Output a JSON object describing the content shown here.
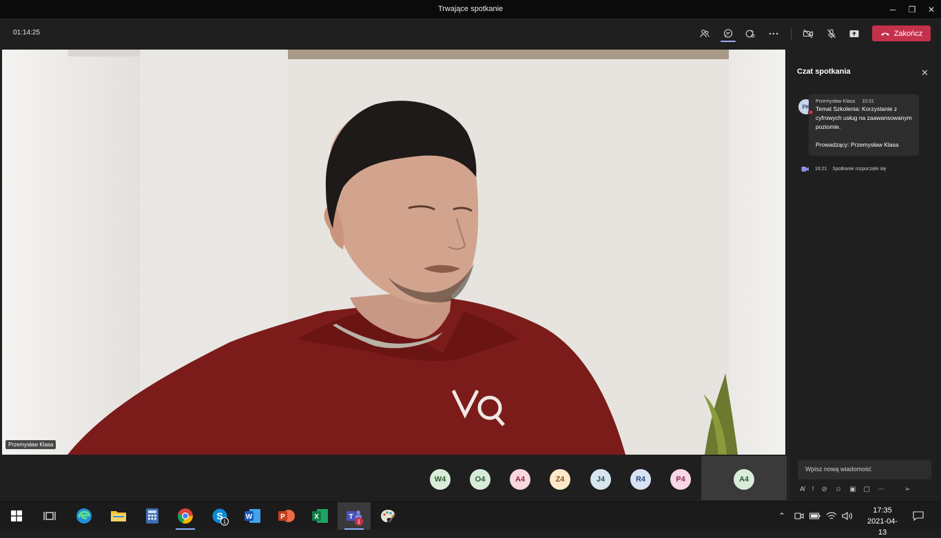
{
  "window": {
    "title": "Trwające spotkanie"
  },
  "toolbar": {
    "timer": "01:14:25",
    "end_label": "Zakończ"
  },
  "video": {
    "participant_name": "Przemysław Klasa"
  },
  "participants": [
    "W4",
    "O4",
    "A4",
    "Z4",
    "J4",
    "R4",
    "P4"
  ],
  "self_tile": "A4",
  "chat": {
    "title": "Czat spotkania",
    "message": {
      "author_initials": "PK",
      "author": "Przemysław Klasa",
      "time": "10:31",
      "text": "Temat Szkolenia: Korzystanie z cyfrowych usług na zaawansowanym poziomie.\n\nProwadzący: Przemysław Klasa"
    },
    "system_event": {
      "time": "16:21",
      "text": "Spotkanie rozpoczęło się"
    },
    "compose_placeholder": "Wpisz nową wiadomość"
  },
  "taskbar": {
    "skype_badge": "1",
    "teams_badge": "1",
    "time": "17:35",
    "date": "2021-04-13"
  },
  "colors": {
    "accent": "#a7a9f5",
    "end_call": "#c4314b",
    "video_bg": "#efece8"
  }
}
